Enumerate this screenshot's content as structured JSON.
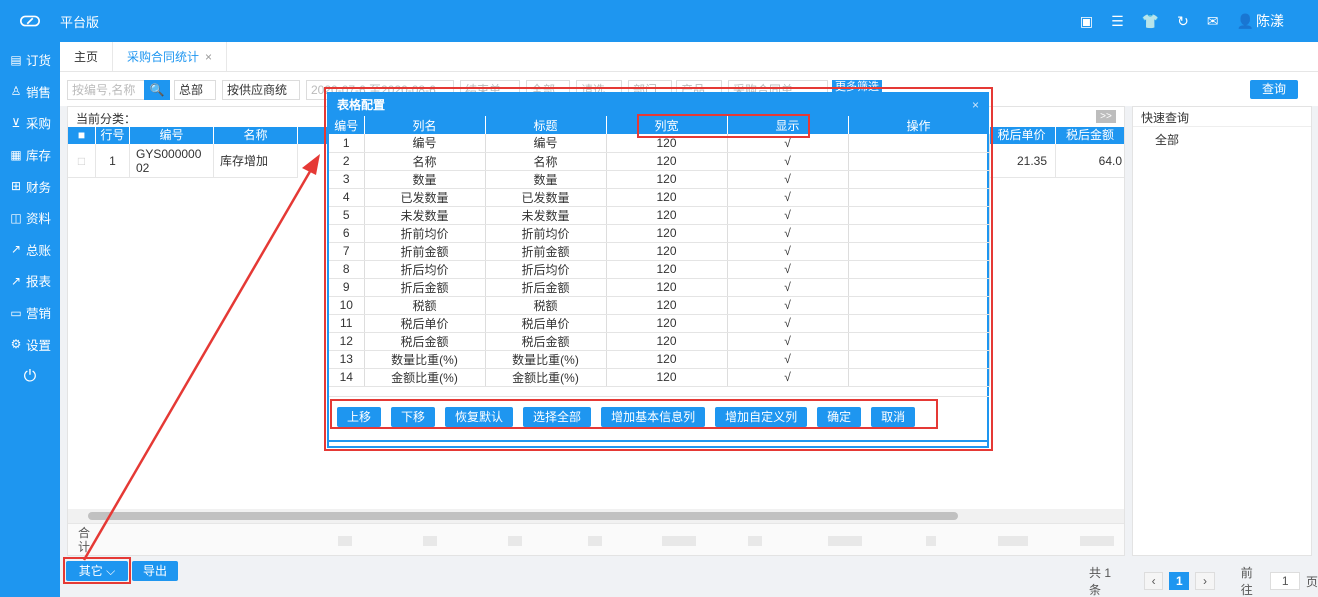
{
  "topbar": {
    "title": "平台版",
    "user_name": "陈漾"
  },
  "sidebar": {
    "items": [
      {
        "label": "订货",
        "icon": "order-icon"
      },
      {
        "label": "销售",
        "icon": "sales-icon"
      },
      {
        "label": "采购",
        "icon": "cart-icon"
      },
      {
        "label": "库存",
        "icon": "inventory-icon"
      },
      {
        "label": "财务",
        "icon": "finance-icon"
      },
      {
        "label": "资料",
        "icon": "profile-icon"
      },
      {
        "label": "总账",
        "icon": "ledger-icon"
      },
      {
        "label": "报表",
        "icon": "report-icon"
      },
      {
        "label": "营销",
        "icon": "marketing-icon"
      },
      {
        "label": "设置",
        "icon": "settings-icon"
      }
    ]
  },
  "tabs": [
    {
      "label": "主页"
    },
    {
      "label": "采购合同统计",
      "close": "×"
    }
  ],
  "filters": {
    "search_placeholder": "按编号,名称",
    "dropdown1": "总部",
    "dropdown2": "按供应商统",
    "date_range": "2020-07-6 至2020-08-6",
    "status1": "结束单",
    "status2": "全部",
    "status3": "请选",
    "status4": "部门",
    "status5": "产品",
    "contract": "采购合同单",
    "more_label": "更多筛选",
    "query_label": "查询"
  },
  "grid": {
    "category_label": "当前分类：",
    "expand_label": ">>",
    "headers": [
      "行号",
      "编号",
      "名称",
      "税后单价",
      "税后金额"
    ],
    "row": {
      "line_no": "1",
      "code": "GYS00000002",
      "name": "库存增加",
      "unit_price_after_tax": "21.35",
      "amount_after_tax": "64.0"
    },
    "total_label": "合计"
  },
  "quick": {
    "title": "快速查询",
    "all_label": "全部"
  },
  "dialog": {
    "title": "表格配置",
    "close": "×",
    "headers": [
      "编号",
      "列名",
      "标题",
      "列宽",
      "显示",
      "操作"
    ],
    "rows": [
      {
        "no": "1",
        "col": "编号",
        "title": "编号",
        "width": "120",
        "show": "√"
      },
      {
        "no": "2",
        "col": "名称",
        "title": "名称",
        "width": "120",
        "show": "√"
      },
      {
        "no": "3",
        "col": "数量",
        "title": "数量",
        "width": "120",
        "show": "√"
      },
      {
        "no": "4",
        "col": "已发数量",
        "title": "已发数量",
        "width": "120",
        "show": "√"
      },
      {
        "no": "5",
        "col": "未发数量",
        "title": "未发数量",
        "width": "120",
        "show": "√"
      },
      {
        "no": "6",
        "col": "折前均价",
        "title": "折前均价",
        "width": "120",
        "show": "√"
      },
      {
        "no": "7",
        "col": "折前金额",
        "title": "折前金额",
        "width": "120",
        "show": "√"
      },
      {
        "no": "8",
        "col": "折后均价",
        "title": "折后均价",
        "width": "120",
        "show": "√"
      },
      {
        "no": "9",
        "col": "折后金额",
        "title": "折后金额",
        "width": "120",
        "show": "√"
      },
      {
        "no": "10",
        "col": "税额",
        "title": "税额",
        "width": "120",
        "show": "√"
      },
      {
        "no": "11",
        "col": "税后单价",
        "title": "税后单价",
        "width": "120",
        "show": "√"
      },
      {
        "no": "12",
        "col": "税后金额",
        "title": "税后金额",
        "width": "120",
        "show": "√"
      },
      {
        "no": "13",
        "col": "数量比重(%)",
        "title": "数量比重(%)",
        "width": "120",
        "show": "√"
      },
      {
        "no": "14",
        "col": "金额比重(%)",
        "title": "金额比重(%)",
        "width": "120",
        "show": "√"
      }
    ],
    "actions": [
      "上移",
      "下移",
      "恢复默认",
      "选择全部",
      "增加基本信息列",
      "增加自定义列",
      "确定",
      "取消"
    ]
  },
  "bottom": {
    "other_label": "其它",
    "export_label": "导出",
    "total_count": "共 1 条",
    "current_page": "1",
    "goto_label": "前往",
    "goto_value": "1",
    "page_unit": "页"
  }
}
